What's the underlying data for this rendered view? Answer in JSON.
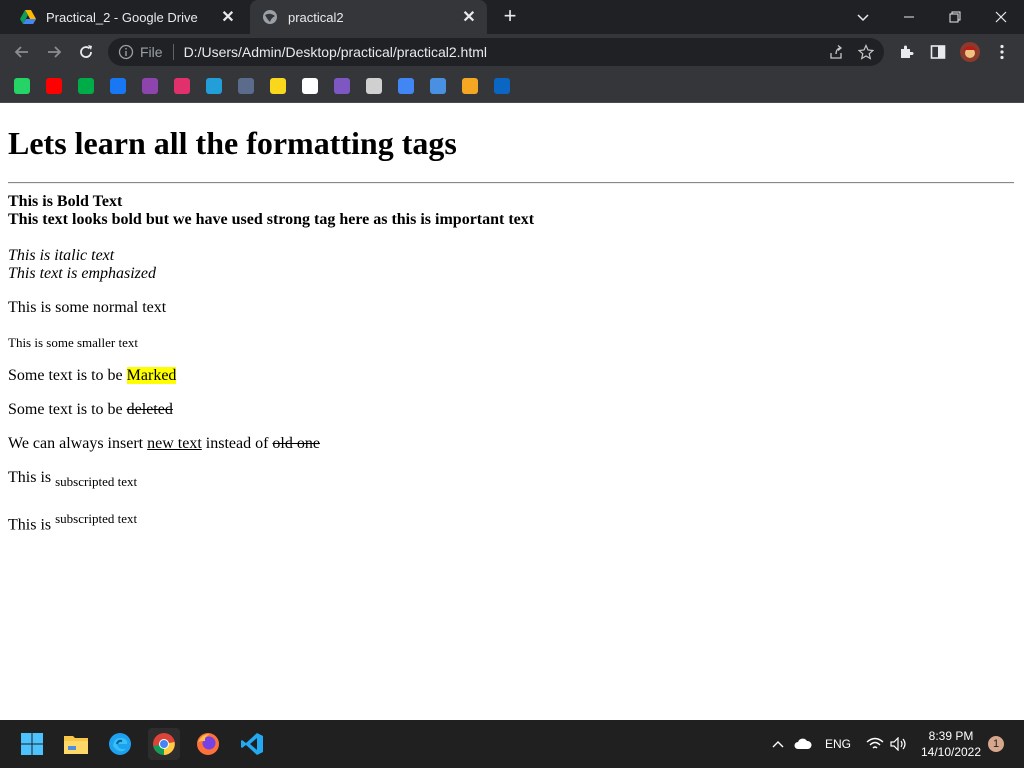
{
  "browser": {
    "tabs": [
      {
        "title": "Practical_2 - Google Drive",
        "active": false
      },
      {
        "title": "practical2",
        "active": true
      }
    ],
    "omnibox": {
      "scheme_label": "File",
      "url": "D:/Users/Admin/Desktop/practical/practical2.html"
    },
    "bookmarks": [
      {
        "name": "whatsapp-icon",
        "color": "#25d366"
      },
      {
        "name": "youtube-icon",
        "color": "#ff0000"
      },
      {
        "name": "meet-icon",
        "color": "#00ac47"
      },
      {
        "name": "facebook-icon",
        "color": "#1877f2"
      },
      {
        "name": "pb-icon",
        "color": "#8e44ad"
      },
      {
        "name": "instagram-icon",
        "color": "#e1306c"
      },
      {
        "name": "telegram-icon",
        "color": "#229ed9"
      },
      {
        "name": "moon-icon",
        "color": "#5a6b8c"
      },
      {
        "name": "notes-icon",
        "color": "#f9d71c"
      },
      {
        "name": "amazon-icon",
        "color": "#ffffff"
      },
      {
        "name": "contact-icon",
        "color": "#7e57c2"
      },
      {
        "name": "globe-icon",
        "color": "#d0d0d0"
      },
      {
        "name": "download-icon",
        "color": "#4285f4"
      },
      {
        "name": "bot-icon",
        "color": "#4a90e2"
      },
      {
        "name": "bars-icon",
        "color": "#f5a623"
      },
      {
        "name": "linkedin-icon",
        "color": "#0a66c2"
      }
    ]
  },
  "page": {
    "heading": "Lets learn all the formatting tags",
    "bold": "This is Bold Text",
    "strong": "This text looks bold but we have used strong tag here as this is important text",
    "italic": "This is italic text",
    "emphasized": "This text is emphasized",
    "normal": "This is some normal text",
    "small": "This is some smaller text",
    "mark_prefix": "Some text is to be ",
    "mark_word": "Marked",
    "del_prefix": "Some text is to be ",
    "del_word": "deleted",
    "ins_prefix": "We can always insert ",
    "ins_word": "new text",
    "ins_middle": " instead of ",
    "ins_del_word": "old one",
    "sub_prefix": "This is ",
    "sub_text": "subscripted text",
    "sup_prefix": "This is ",
    "sup_text": "subscripted text"
  },
  "taskbar": {
    "lang": "ENG",
    "time": "8:39 PM",
    "date": "14/10/2022",
    "notification_count": "1"
  }
}
